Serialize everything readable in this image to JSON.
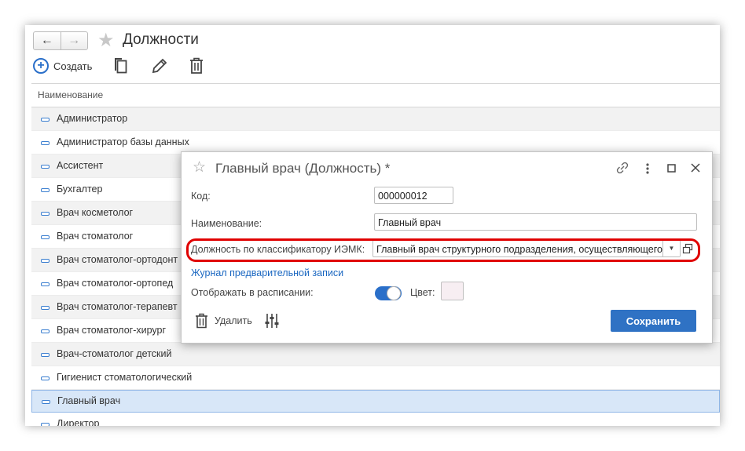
{
  "header": {
    "back_icon": "arrow-left-icon",
    "forward_icon": "arrow-right-icon",
    "favorite_icon": "star-icon",
    "title": "Должности"
  },
  "toolbar": {
    "create_label": "Создать",
    "copy_icon": "copy-icon",
    "edit_icon": "pencil-icon",
    "delete_icon": "trash-icon"
  },
  "list": {
    "column_header": "Наименование",
    "items": [
      {
        "label": "Администратор"
      },
      {
        "label": "Администратор базы данных"
      },
      {
        "label": "Ассистент"
      },
      {
        "label": "Бухгалтер"
      },
      {
        "label": "Врач косметолог"
      },
      {
        "label": "Врач стоматолог"
      },
      {
        "label": "Врач стоматолог-ортодонт"
      },
      {
        "label": "Врач стоматолог-ортопед"
      },
      {
        "label": "Врач стоматолог-терапевт"
      },
      {
        "label": "Врач стоматолог-хирург"
      },
      {
        "label": "Врач-стоматолог детский"
      },
      {
        "label": "Гигиенист стоматологический"
      },
      {
        "label": "Главный врач"
      },
      {
        "label": "Директор"
      }
    ],
    "selected_index": 12
  },
  "dialog": {
    "title": "Главный врач (Должность) *",
    "code_label": "Код:",
    "code_value": "000000012",
    "name_label": "Наименование:",
    "name_value": "Главный врач",
    "classifier_label": "Должность по классификатору ИЭМК:",
    "classifier_value": "Главный врач структурного подразделения, осуществляющего медицинскую деятельность",
    "journal_link": "Журнал предварительной записи",
    "show_in_schedule_label": "Отображать в расписании:",
    "show_in_schedule_on": true,
    "color_label": "Цвет:",
    "color_value": "#f7eef2",
    "delete_label": "Удалить",
    "save_label": "Сохранить"
  },
  "colors": {
    "accent": "#2f72c4",
    "highlight": "#e00000",
    "selected_row": "#d8e7f8"
  }
}
